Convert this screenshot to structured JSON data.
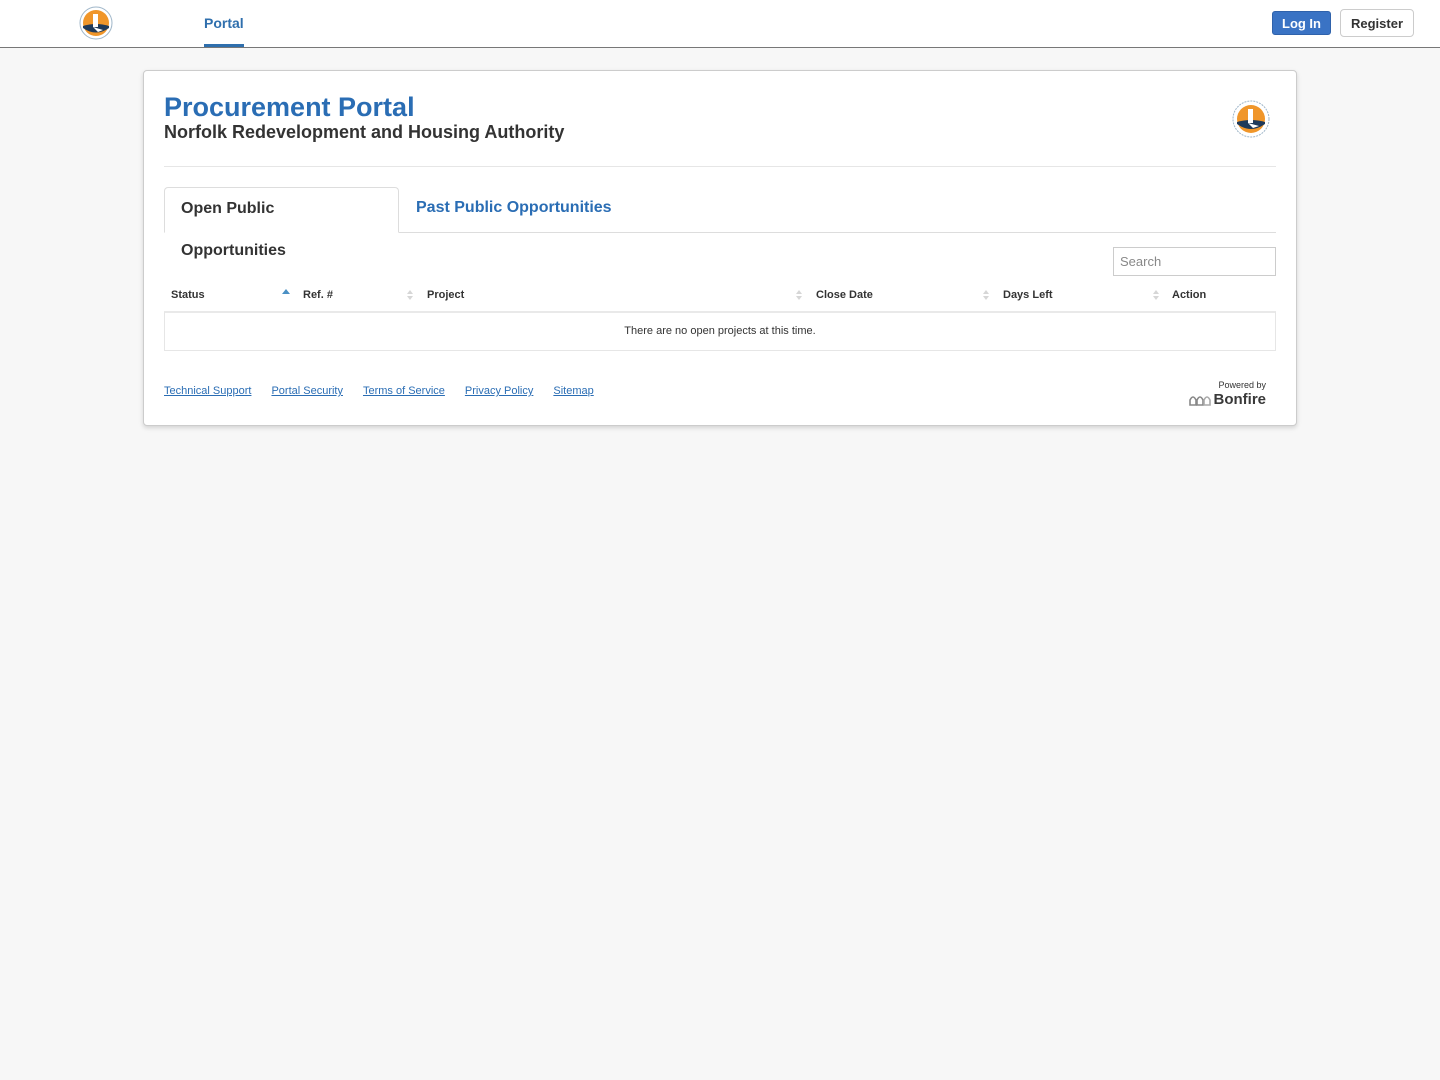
{
  "topbar": {
    "logo_alt": "Norfolk Redevelopment and Housing Authority logo",
    "nav": [
      {
        "label": "Portal",
        "active": true
      }
    ],
    "login_label": "Log In",
    "register_label": "Register"
  },
  "header": {
    "title": "Procurement Portal",
    "subtitle": "Norfolk Redevelopment and Housing Authority"
  },
  "tabs": [
    {
      "label": "Open Public Opportunities",
      "active": true
    },
    {
      "label": "Past Public Opportunities",
      "active": false
    }
  ],
  "search": {
    "placeholder": "Search",
    "value": ""
  },
  "table": {
    "columns": [
      {
        "label": "Status",
        "sort": "ascending"
      },
      {
        "label": "Ref. #",
        "sort": "none"
      },
      {
        "label": "Project",
        "sort": "none"
      },
      {
        "label": "Close Date",
        "sort": "none"
      },
      {
        "label": "Days Left",
        "sort": "none"
      },
      {
        "label": "Action",
        "sort": "none"
      }
    ],
    "empty_message": "There are no open projects at this time."
  },
  "footer": {
    "links": [
      "Technical Support",
      "Portal Security",
      "Terms of Service",
      "Privacy Policy",
      "Sitemap"
    ],
    "powered_by": "Powered by",
    "brand": "Bonfire"
  },
  "colors": {
    "accent": "#2a6db4",
    "login_button": "#3a73c4",
    "logo_orange": "#f0962a",
    "logo_navy": "#1f3a5a"
  }
}
